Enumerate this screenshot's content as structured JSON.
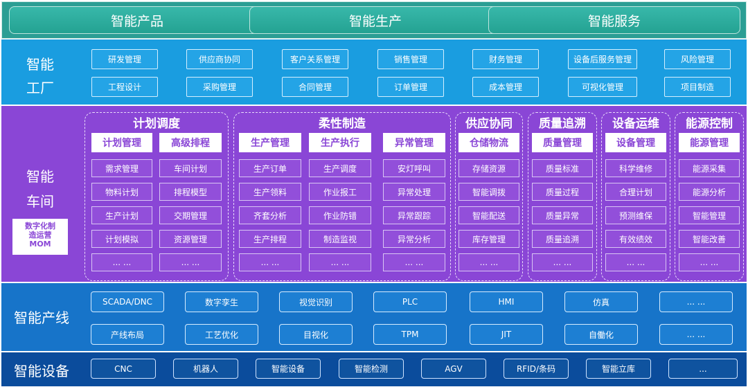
{
  "top": {
    "tabs": [
      "智能产品",
      "智能生产",
      "智能服务"
    ]
  },
  "factory": {
    "title_line1": "智能",
    "title_line2": "工厂",
    "row1": [
      "研发管理",
      "供应商协同",
      "客户关系管理",
      "销售管理",
      "财务管理",
      "设备后服务管理",
      "风险管理"
    ],
    "row2": [
      "工程设计",
      "采购管理",
      "合同管理",
      "订单管理",
      "成本管理",
      "可视化管理",
      "项目制造"
    ]
  },
  "workshop": {
    "title_line1": "智能",
    "title_line2": "车间",
    "mom_line1": "数字化制",
    "mom_line2": "造运营",
    "mom_line3": "MOM",
    "groups": [
      {
        "title": "计划调度",
        "columns": [
          {
            "header": "计划管理",
            "items": [
              "需求管理",
              "物料计划",
              "生产计划",
              "计划模拟",
              "... ..."
            ]
          },
          {
            "header": "高级排程",
            "items": [
              "车间计划",
              "排程模型",
              "交期管理",
              "资源管理",
              "... ..."
            ]
          }
        ]
      },
      {
        "title": "柔性制造",
        "columns": [
          {
            "header": "生产管理",
            "items": [
              "生产订单",
              "生产领料",
              "齐套分析",
              "生产排程",
              "... ..."
            ]
          },
          {
            "header": "生产执行",
            "items": [
              "生产调度",
              "作业报工",
              "作业防错",
              "制造监视",
              "... ..."
            ]
          },
          {
            "header": "异常管理",
            "items": [
              "安灯呼叫",
              "异常处理",
              "异常跟踪",
              "异常分析",
              "... ..."
            ]
          }
        ]
      },
      {
        "title": "供应协同",
        "columns": [
          {
            "header": "仓储物流",
            "items": [
              "存储资源",
              "智能调拨",
              "智能配送",
              "库存管理",
              "... ..."
            ]
          }
        ]
      },
      {
        "title": "质量追溯",
        "columns": [
          {
            "header": "质量管理",
            "items": [
              "质量标准",
              "质量过程",
              "质量异常",
              "质量追溯",
              "... ..."
            ]
          }
        ]
      },
      {
        "title": "设备运维",
        "columns": [
          {
            "header": "设备管理",
            "items": [
              "科学维修",
              "合理计划",
              "预测维保",
              "有效绩效",
              "... ..."
            ]
          }
        ]
      },
      {
        "title": "能源控制",
        "columns": [
          {
            "header": "能源管理",
            "items": [
              "能源采集",
              "能源分析",
              "智能管理",
              "智能改善",
              "... ..."
            ]
          }
        ]
      }
    ]
  },
  "line": {
    "title": "智能产线",
    "row1": [
      "SCADA/DNC",
      "数字孪生",
      "视觉识别",
      "PLC",
      "HMI",
      "仿真",
      "... ..."
    ],
    "row2": [
      "产线布局",
      "工艺优化",
      "目视化",
      "TPM",
      "JIT",
      "自働化",
      "... ..."
    ]
  },
  "equipment": {
    "title": "智能设备",
    "items": [
      "CNC",
      "机器人",
      "智能设备",
      "智能检测",
      "AGV",
      "RFID/条码",
      "智能立库",
      "..."
    ]
  }
}
